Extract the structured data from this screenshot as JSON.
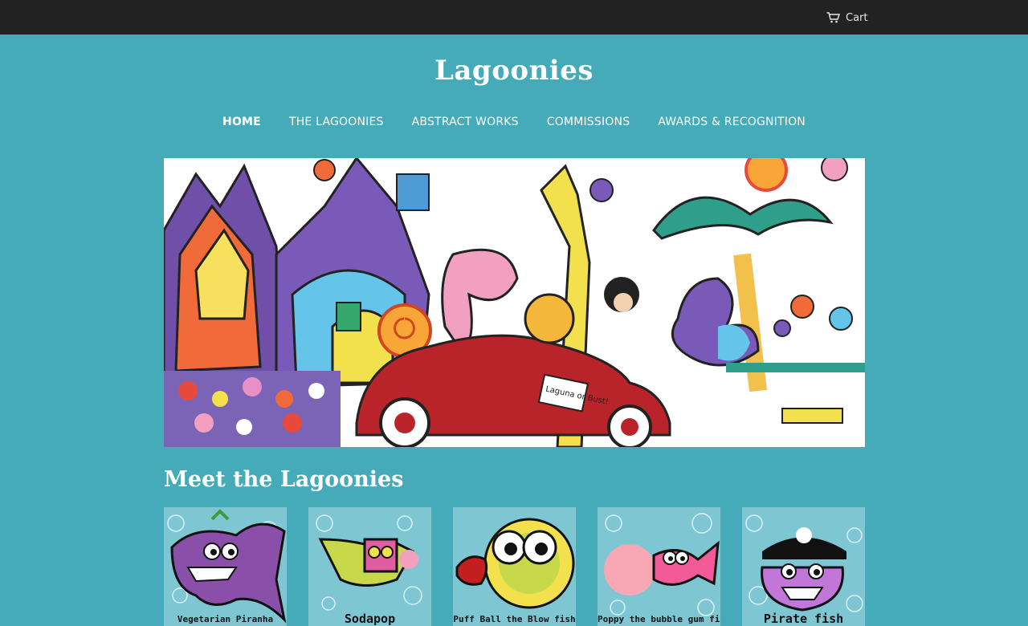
{
  "header": {
    "cart_label": "Cart",
    "cart_icon": "shopping-cart-icon"
  },
  "site": {
    "title": "Lagoonies"
  },
  "nav": {
    "items": [
      {
        "label": "HOME",
        "active": true
      },
      {
        "label": "THE LAGOONIES",
        "active": false
      },
      {
        "label": "ABSTRACT WORKS",
        "active": false
      },
      {
        "label": "COMMISSIONS",
        "active": false
      },
      {
        "label": "AWARDS & RECOGNITION",
        "active": false
      }
    ]
  },
  "hero": {
    "car_sign": "Laguna or Bust!"
  },
  "section": {
    "title": "Meet the Lagoonies"
  },
  "products": [
    {
      "caption": "Vegetarian Piranha"
    },
    {
      "caption": "Sodapop"
    },
    {
      "caption": "Puff Ball the Blow fish"
    },
    {
      "caption": "Poppy the bubble gum fish"
    },
    {
      "caption": "Pirate fish"
    }
  ],
  "colors": {
    "background": "#45abb8",
    "topbar": "#222222",
    "text": "#ffffff"
  }
}
